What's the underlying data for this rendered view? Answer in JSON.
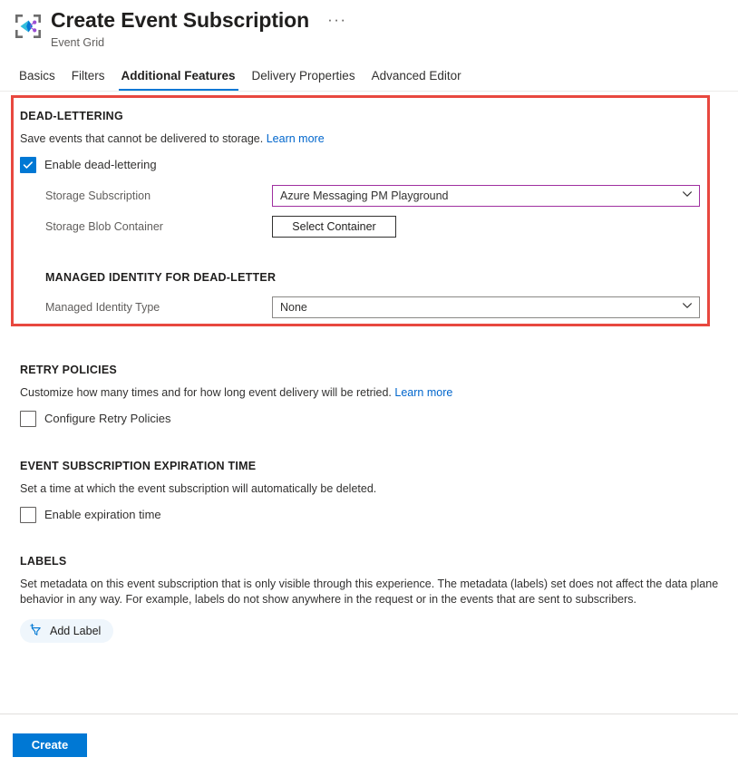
{
  "header": {
    "title": "Create Event Subscription",
    "subtitle": "Event Grid",
    "more_menu": "···",
    "icon": "event-grid-icon"
  },
  "tabs": [
    {
      "label": "Basics",
      "active": false
    },
    {
      "label": "Filters",
      "active": false
    },
    {
      "label": "Additional Features",
      "active": true
    },
    {
      "label": "Delivery Properties",
      "active": false
    },
    {
      "label": "Advanced Editor",
      "active": false
    }
  ],
  "highlight": {
    "color": "#e8483f"
  },
  "dead_lettering": {
    "title": "DEAD-LETTERING",
    "description": "Save events that cannot be delivered to storage.",
    "learn_more": "Learn more",
    "enable_label": "Enable dead-lettering",
    "enabled": true,
    "storage_subscription_label": "Storage Subscription",
    "storage_subscription_value": "Azure Messaging PM Playground",
    "storage_subscription_focus_color": "#9f2fa0",
    "storage_blob_container_label": "Storage Blob Container",
    "select_container_button": "Select Container",
    "managed_identity_title": "MANAGED IDENTITY FOR DEAD-LETTER",
    "managed_identity_label": "Managed Identity Type",
    "managed_identity_value": "None"
  },
  "retry_policies": {
    "title": "RETRY POLICIES",
    "description": "Customize how many times and for how long event delivery will be retried.",
    "learn_more": "Learn more",
    "checkbox_label": "Configure Retry Policies",
    "checked": false
  },
  "expiration": {
    "title": "EVENT SUBSCRIPTION EXPIRATION TIME",
    "description": "Set a time at which the event subscription will automatically be deleted.",
    "checkbox_label": "Enable expiration time",
    "checked": false
  },
  "labels": {
    "title": "LABELS",
    "description_line1": "Set metadata on this event subscription that is only visible through this experience. The metadata (labels) set does not affect the data plane",
    "description_line2": "behavior in any way. For example, labels do not show anywhere in the request or in the events that are sent to subscribers.",
    "add_label_button": "Add Label",
    "add_label_icon": "add-filter-icon"
  },
  "footer": {
    "create_button": "Create",
    "accent_color": "#0078d4"
  }
}
